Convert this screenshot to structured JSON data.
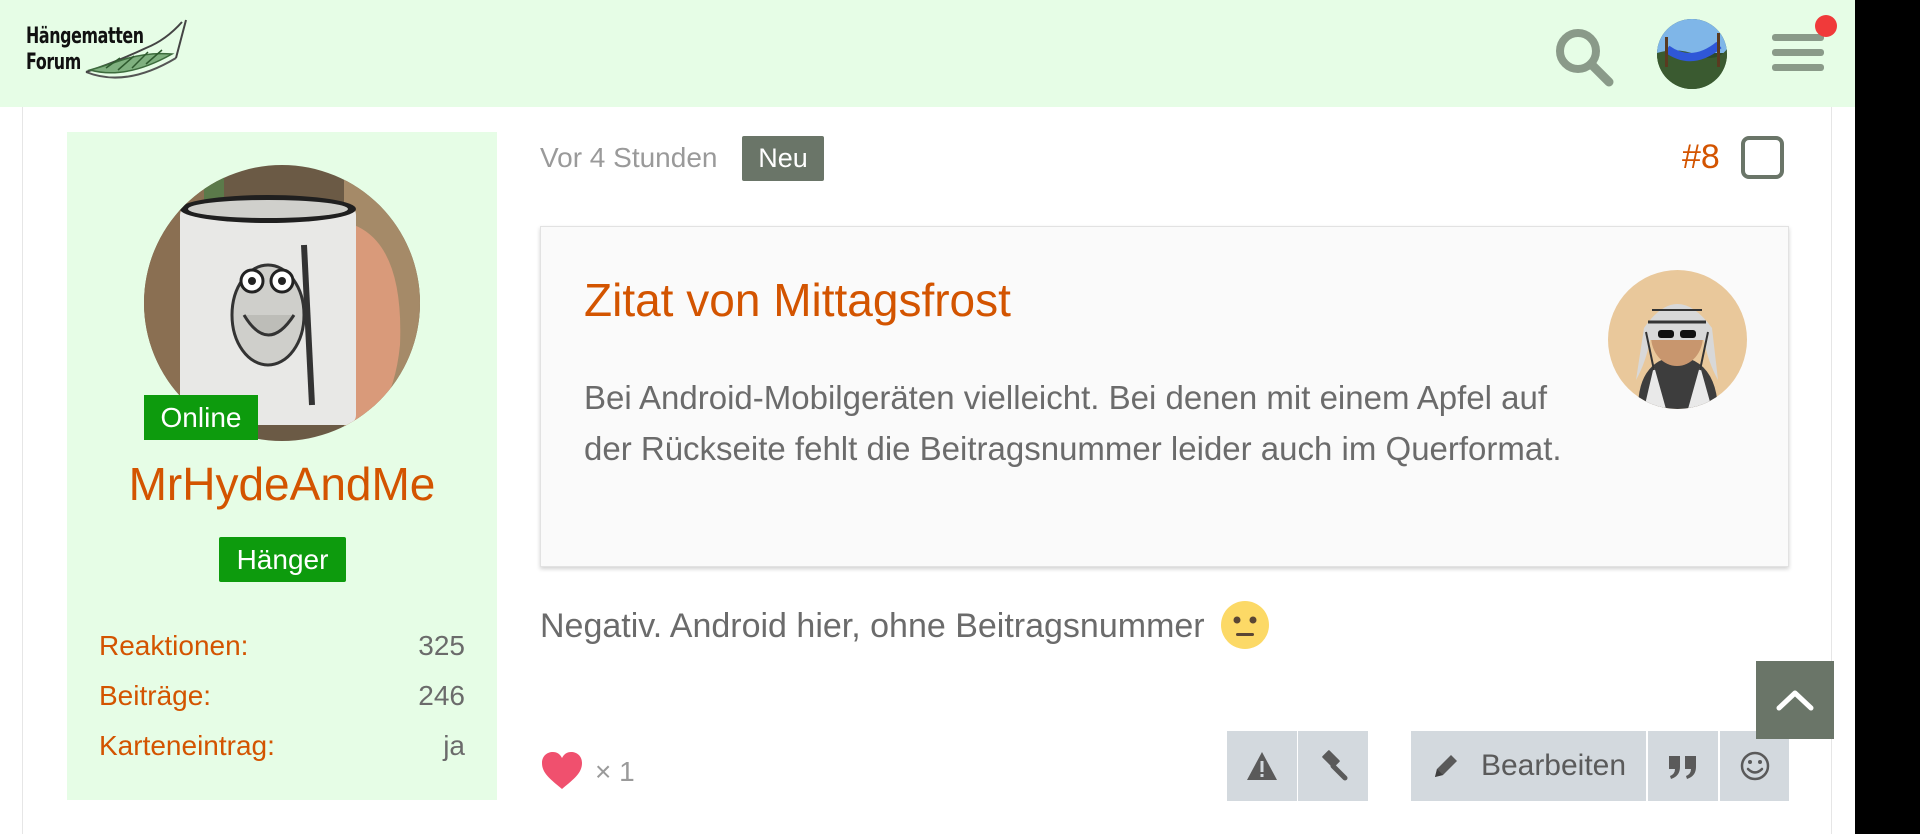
{
  "header": {
    "logo_line1": "Hängematten",
    "logo_line2": "Forum",
    "notification_dot_color": "#f03a3a"
  },
  "icons": {
    "search": "search-icon",
    "menu": "hamburger-menu-icon",
    "like": "heart-icon",
    "report": "warning-icon",
    "moderate": "gavel-icon",
    "edit": "pencil-icon",
    "quote": "quote-icon",
    "react": "smiley-icon",
    "scroll_top": "chevron-up-icon",
    "reaction_emoji": "neutral-face-emoji"
  },
  "user": {
    "status": "Online",
    "name": "MrHydeAndMe",
    "rank": "Hänger",
    "stats": [
      {
        "label": "Reaktionen",
        "value": "325"
      },
      {
        "label": "Beiträge",
        "value": "246"
      },
      {
        "label": "Karteneintrag",
        "value": "ja"
      }
    ]
  },
  "post": {
    "time": "Vor 4 Stunden",
    "new_badge": "Neu",
    "number": "#8",
    "quote": {
      "title": "Zitat von Mittagsfrost",
      "text": "Bei Android-Mobilgeräten vielleicht. Bei denen mit einem Apfel auf der Rückseite fehlt die Beitragsnummer leider auch im Querformat."
    },
    "body": "Negativ. Android hier, ohne Beitragsnummer",
    "likes": "× 1",
    "edit_label": "Bearbeiten"
  },
  "colors": {
    "accent": "#d35400",
    "header_bg": "#e6fde6",
    "online_green": "#0d9b0d",
    "badge_gray": "#6a7568",
    "button_bg": "#d3d9de",
    "like_pink": "#f0506e"
  }
}
